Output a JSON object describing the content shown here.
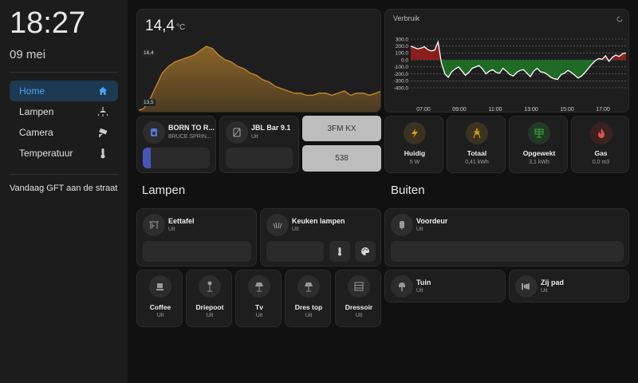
{
  "sidebar": {
    "time": "18:27",
    "date": "09 mei",
    "items": [
      {
        "label": "Home",
        "icon": "home-icon"
      },
      {
        "label": "Lampen",
        "icon": "ceiling-light-icon"
      },
      {
        "label": "Camera",
        "icon": "cctv-icon"
      },
      {
        "label": "Temperatuur",
        "icon": "thermometer-icon"
      }
    ],
    "notice": "Vandaag GFT aan de straat"
  },
  "temperature": {
    "value": "14,4",
    "unit": "°C",
    "max_label": "16,4",
    "min_label": "13,5",
    "chart_data": {
      "type": "area",
      "y_min": 13.5,
      "y_max": 16.4,
      "values": [
        13.5,
        13.6,
        14.0,
        14.6,
        15.2,
        15.5,
        15.7,
        15.8,
        15.9,
        16.0,
        16.2,
        16.4,
        16.3,
        16.0,
        15.8,
        15.7,
        15.5,
        15.4,
        15.2,
        15.1,
        14.9,
        14.8,
        14.6,
        14.5,
        14.4,
        14.3,
        14.3,
        14.2,
        14.2,
        14.3,
        14.3,
        14.2,
        14.3,
        14.4,
        14.2,
        14.3,
        14.3,
        14.2,
        14.3,
        14.4
      ]
    }
  },
  "usage": {
    "title": "Verbruik",
    "chart_data": {
      "type": "line",
      "y_ticks": [
        "300.0",
        "200.0",
        "100.0",
        "0.0",
        "-100.0",
        "-200.0",
        "-300.0",
        "-400.0"
      ],
      "x_ticks": [
        "07:00",
        "09:00",
        "11:00",
        "13:00",
        "15:00",
        "17:00"
      ],
      "ylim": [
        -400,
        300
      ],
      "values": [
        200,
        180,
        160,
        170,
        190,
        150,
        130,
        140,
        260,
        -50,
        -200,
        -250,
        -170,
        -130,
        -100,
        -160,
        -220,
        -180,
        -120,
        -100,
        -80,
        -130,
        -200,
        -160,
        -140,
        -180,
        -190,
        -120,
        -160,
        -210,
        -230,
        -180,
        -150,
        -140,
        -190,
        -240,
        -160,
        -120,
        -170,
        -180,
        -210,
        -250,
        -270,
        -280,
        -210,
        -190,
        -150,
        -180,
        -220,
        -260,
        -230,
        -180,
        -120,
        -60,
        -10,
        20,
        10,
        60,
        -20,
        40,
        70,
        50,
        90,
        100
      ]
    }
  },
  "media": [
    {
      "title": "BORN TO R...",
      "subtitle": "BRUCE SPRIN...",
      "progress": 0.12
    },
    {
      "title": "JBL Bar 9.1",
      "subtitle": "Uit"
    }
  ],
  "radio_buttons": [
    "3FM KX",
    "538"
  ],
  "energy": [
    {
      "name": "Huidig",
      "value": "5 W",
      "color": "#d4a017"
    },
    {
      "name": "Totaal",
      "value": "0,41 kWh",
      "color": "#d4a017"
    },
    {
      "name": "Opgewekt",
      "value": "3,1 kWh",
      "color": "#3cb043"
    },
    {
      "name": "Gas",
      "value": "0,0 m3",
      "color": "#d9534f"
    }
  ],
  "sections": {
    "lampen": "Lampen",
    "buiten": "Buiten"
  },
  "lamp_cards": [
    {
      "name": "Eettafel",
      "state": "Uit"
    },
    {
      "name": "Keuken lampen",
      "state": "Uit"
    }
  ],
  "small_lamps": [
    {
      "name": "Coffee",
      "state": "Uit"
    },
    {
      "name": "Driepoot",
      "state": "Uit"
    },
    {
      "name": "Tv",
      "state": "Uit"
    },
    {
      "name": "Dres top",
      "state": "Uit"
    },
    {
      "name": "Dressoir",
      "state": "Uit"
    }
  ],
  "outdoor": [
    {
      "name": "Voordeur",
      "state": "Uit"
    },
    {
      "name": "Tuin",
      "state": "Uit"
    },
    {
      "name": "Zij pad",
      "state": "Uit"
    }
  ]
}
